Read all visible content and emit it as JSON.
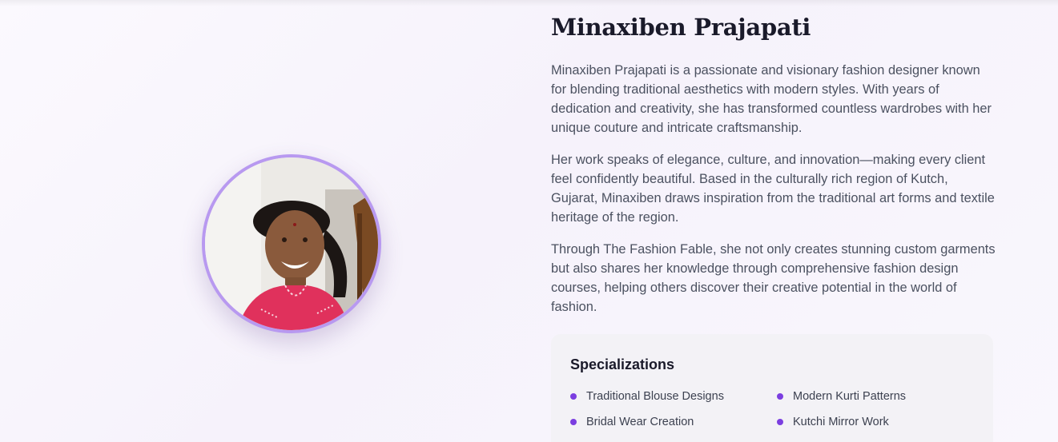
{
  "profile": {
    "name": "Minaxiben Prajapati",
    "bio": [
      "Minaxiben Prajapati is a passionate and visionary fashion designer known for blending traditional aesthetics with modern styles. With years of dedication and creativity, she has transformed countless wardrobes with her unique couture and intricate craftsmanship.",
      "Her work speaks of elegance, culture, and innovation—making every client feel confidently beautiful. Based in the culturally rich region of Kutch, Gujarat, Minaxiben draws inspiration from the traditional art forms and textile heritage of the region.",
      "Through The Fashion Fable, she not only creates stunning custom garments but also shares her knowledge through comprehensive fashion design courses, helping others discover their creative potential in the world of fashion."
    ]
  },
  "specializations": {
    "title": "Specializations",
    "items": [
      "Traditional Blouse Designs",
      "Modern Kurti Patterns",
      "Bridal Wear Creation",
      "Kutchi Mirror Work"
    ]
  },
  "colors": {
    "accent": "#7b3ee0",
    "avatar_ring": "#b899f0",
    "heading": "#1a1a2a",
    "body_text": "#4b5160",
    "card_bg": "#f3f2f6"
  },
  "icons": {
    "bullet": "purple-dot-icon"
  }
}
